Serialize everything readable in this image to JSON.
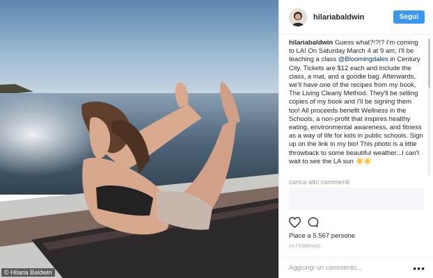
{
  "photo": {
    "credit": "© Hilaria Baldwin"
  },
  "header": {
    "username": "hilariabaldwin",
    "follow_label": "Segui"
  },
  "caption": {
    "username": "hilariabaldwin",
    "text_part1": " Guess what?!?!? I'm coming to LA! On Saturday March 4 at 9 am, I'll be teaching a class ",
    "mention": "@Bloomingdales",
    "text_part2": " in Century City. Tickets are $12 each and include the class, a mat, and a goodie bag. Afterwards, we'll have one of the recipes from my book, The Living Clearly Method. They'll be selling copies of my book and I'll be signing them too! All proceeds benefit Wellness in the Schools, a non-profit that inspires healthy eating, environmental awareness, and fitness as a way of life for kids in public schools. Sign up on the link in my bio! This photo is a little throwback to some beautiful weather...I can't wait to see the LA sun ☀️☀️"
  },
  "load_more": "carica altri commenti",
  "likes": "Piace a 5.567 persone",
  "date": "24 FEBBRAIO",
  "comment_placeholder": "Aggiungi un commento...",
  "more_options": "•••",
  "icons": [
    "heart-icon",
    "comment-icon"
  ]
}
